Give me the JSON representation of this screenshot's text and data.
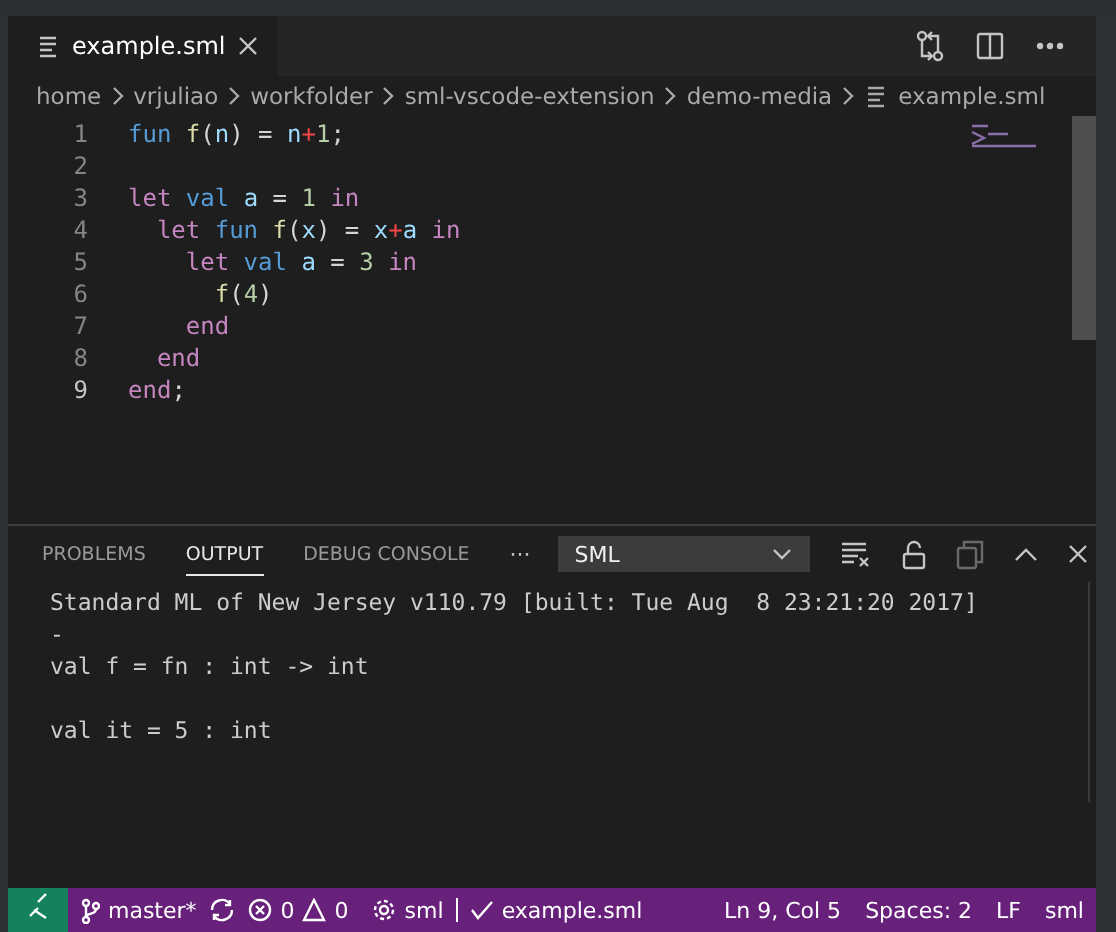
{
  "tabs": [
    {
      "label": "example.sml",
      "selected": true
    }
  ],
  "breadcrumbs": [
    "home",
    "vrjuliao",
    "workfolder",
    "sml-vscode-extension",
    "demo-media",
    "example.sml"
  ],
  "code_lines": [
    {
      "number": "1",
      "current": false,
      "tokens": [
        {
          "kind": "storage",
          "text": "fun "
        },
        {
          "kind": "function",
          "text": "f"
        },
        {
          "kind": "plain",
          "text": "("
        },
        {
          "kind": "variable",
          "text": "n"
        },
        {
          "kind": "plain",
          "text": ") = "
        },
        {
          "kind": "variable",
          "text": "n"
        },
        {
          "kind": "operator",
          "text": "+"
        },
        {
          "kind": "number",
          "text": "1"
        },
        {
          "kind": "plain",
          "text": ";"
        }
      ]
    },
    {
      "number": "2",
      "current": false
    },
    {
      "number": "3",
      "current": false,
      "tokens": [
        {
          "kind": "keyword",
          "text": "let "
        },
        {
          "kind": "storage",
          "text": "val "
        },
        {
          "kind": "variable",
          "text": "a"
        },
        {
          "kind": "plain",
          "text": " = "
        },
        {
          "kind": "number",
          "text": "1 "
        },
        {
          "kind": "keyword",
          "text": "in"
        }
      ]
    },
    {
      "number": "4",
      "current": false,
      "tokens": [
        {
          "kind": "keyword",
          "text": "  let "
        },
        {
          "kind": "storage",
          "text": "fun "
        },
        {
          "kind": "function",
          "text": "f"
        },
        {
          "kind": "plain",
          "text": "("
        },
        {
          "kind": "variable",
          "text": "x"
        },
        {
          "kind": "plain",
          "text": ") = "
        },
        {
          "kind": "variable",
          "text": "x"
        },
        {
          "kind": "operator",
          "text": "+"
        },
        {
          "kind": "variable",
          "text": "a "
        },
        {
          "kind": "keyword",
          "text": "in"
        }
      ]
    },
    {
      "number": "5",
      "current": false,
      "tokens": [
        {
          "kind": "keyword",
          "text": "    let "
        },
        {
          "kind": "storage",
          "text": "val "
        },
        {
          "kind": "variable",
          "text": "a"
        },
        {
          "kind": "plain",
          "text": " = "
        },
        {
          "kind": "number",
          "text": "3 "
        },
        {
          "kind": "keyword",
          "text": "in"
        }
      ]
    },
    {
      "number": "6",
      "current": false,
      "tokens": [
        {
          "kind": "function",
          "text": "      f"
        },
        {
          "kind": "plain",
          "text": "("
        },
        {
          "kind": "number",
          "text": "4"
        },
        {
          "kind": "plain",
          "text": ")"
        }
      ]
    },
    {
      "number": "7",
      "current": false,
      "tokens": [
        {
          "kind": "keyword",
          "text": "    end"
        }
      ]
    },
    {
      "number": "8",
      "current": false,
      "tokens": [
        {
          "kind": "keyword",
          "text": "  end"
        }
      ]
    },
    {
      "number": "9",
      "current": true,
      "tokens": [
        {
          "kind": "keyword",
          "text": "end"
        },
        {
          "kind": "plain",
          "text": ";"
        }
      ]
    }
  ],
  "panel_tabs": [
    {
      "label": "PROBLEMS",
      "selected": false
    },
    {
      "label": "OUTPUT",
      "selected": true
    },
    {
      "label": "DEBUG CONSOLE",
      "selected": false
    }
  ],
  "panel_more": "···",
  "output_channel": "SML",
  "output_lines": [
    {
      "text": "Standard ML of New Jersey v110.79 [built: Tue Aug  8 23:21:20 2017]",
      "blank_before": false
    },
    {
      "text": "-",
      "blank_before": false
    },
    {
      "text": "val f = fn : int -> int",
      "blank_before": false
    },
    {
      "text": "val it = 5 : int",
      "blank_before": true
    }
  ],
  "status_bar": {
    "branch": "master*",
    "errors": "0",
    "warnings": "0",
    "language_status": "sml",
    "file_status": "example.sml",
    "position": "Ln 9, Col 5",
    "indent": "Spaces: 2",
    "eol": "LF",
    "language": "sml"
  }
}
